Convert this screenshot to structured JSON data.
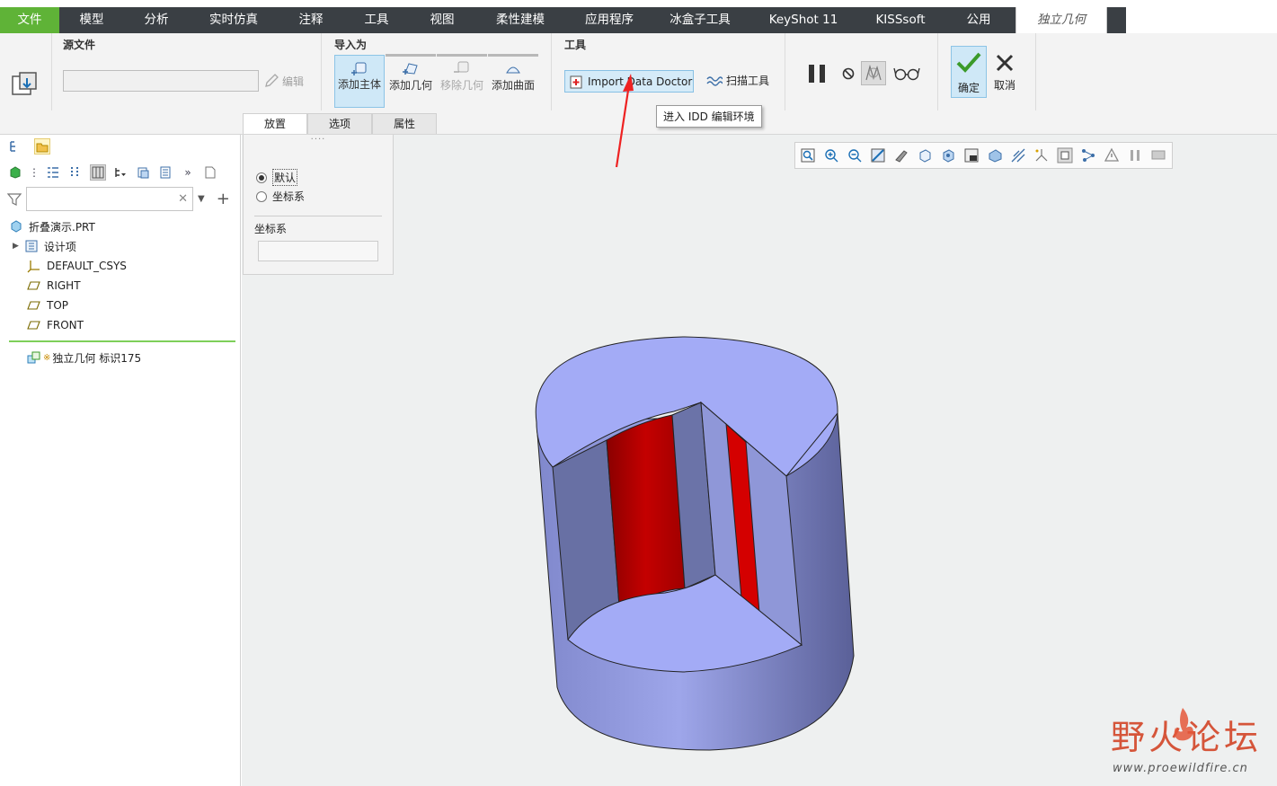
{
  "menu": {
    "tabs": [
      "文件",
      "模型",
      "分析",
      "实时仿真",
      "注释",
      "工具",
      "视图",
      "柔性建模",
      "应用程序",
      "冰盒子工具",
      "KeyShot 11",
      "KISSsoft",
      "公用",
      "独立几何"
    ]
  },
  "ribbon": {
    "source_group_title": "源文件",
    "edit_label": "编辑",
    "import_group_title": "导入为",
    "import_buttons": [
      "添加主体",
      "添加几何",
      "移除几何",
      "添加曲面"
    ],
    "tools_group_title": "工具",
    "idd_button_label": "Import Data Doctor",
    "scan_tool_label": "扫描工具",
    "ok_label": "确定",
    "cancel_label": "取消",
    "subtabs": [
      "放置",
      "选项",
      "属性"
    ]
  },
  "tooltip": "进入 IDD 编辑环境",
  "placement": {
    "radio_default": "默认",
    "radio_csys": "坐标系",
    "csys_label": "坐标系",
    "handle": "····"
  },
  "tree": {
    "root": "折叠演示.PRT",
    "items": [
      "设计项",
      "DEFAULT_CSYS",
      "RIGHT",
      "TOP",
      "FRONT"
    ],
    "feature_marker": "※",
    "feature": "独立几何 标识175"
  },
  "watermark": {
    "title": "野火论坛",
    "url": "www.proewildfire.cn"
  },
  "colors": {
    "file_tab": "#5fb337",
    "menubar": "#3a3f44",
    "selection": "#cfe8f7",
    "model_face": "#9fa8f0",
    "model_red": "#cc0000"
  }
}
